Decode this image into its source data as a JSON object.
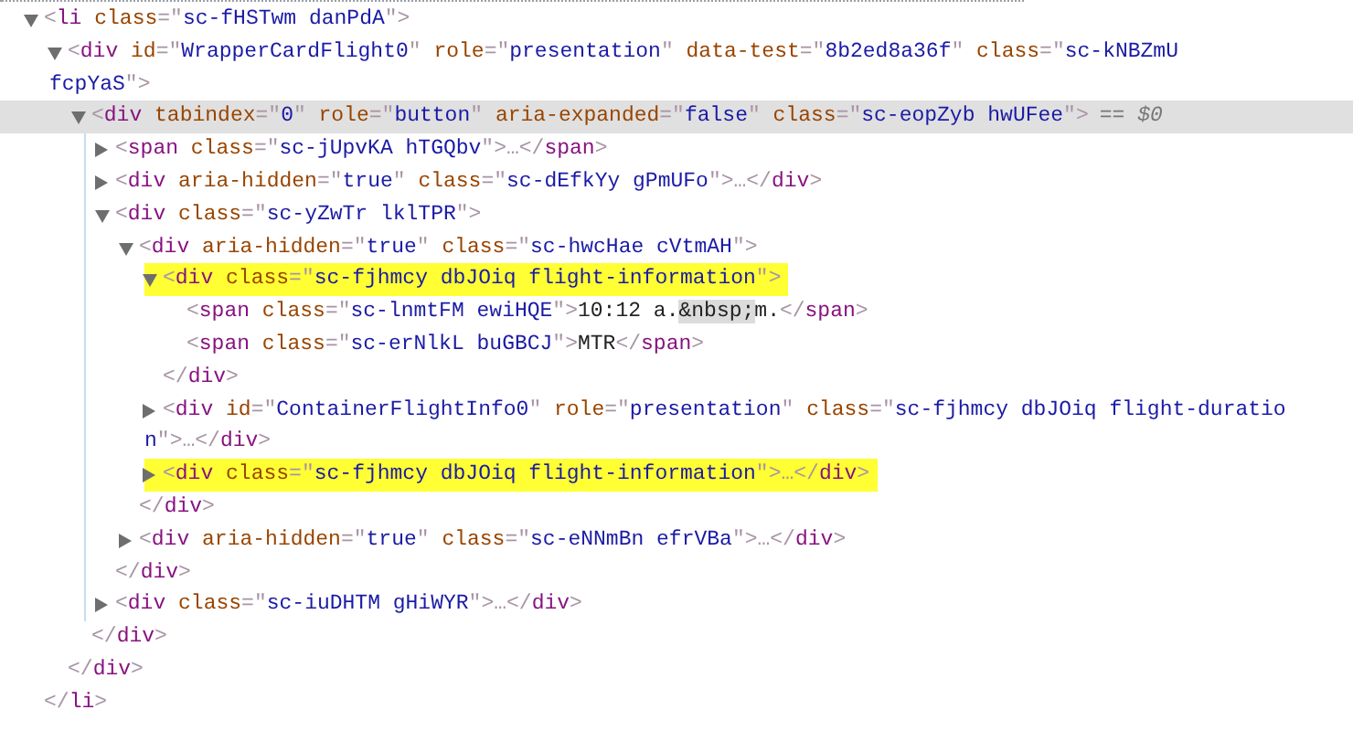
{
  "elements_tree": [
    {
      "kind": "toggle",
      "expanded": true,
      "selected": false,
      "highlighted": false,
      "lines": [
        "<li class=\"sc-fHSTwm danPdA\">"
      ],
      "close": "</li>",
      "children": [
        {
          "kind": "toggle",
          "expanded": true,
          "selected": false,
          "highlighted": false,
          "lines": [
            "<div id=\"WrapperCardFlight0\" role=\"presentation\" data-test=\"8b2ed8a36f\" class=\"sc-kNBZmU",
            "fcpYaS\">"
          ],
          "close": "</div>",
          "children": [
            {
              "kind": "toggle",
              "expanded": true,
              "selected": true,
              "highlighted": false,
              "lines": [
                "<div tabindex=\"0\" role=\"button\" aria-expanded=\"false\" class=\"sc-eopZyb hwUFee\">"
              ],
              "marker": "== $0",
              "close": "</div>",
              "children": [
                {
                  "kind": "toggle",
                  "expanded": false,
                  "selected": false,
                  "highlighted": false,
                  "lines": [
                    "<span class=\"sc-jUpvKA hTGQbv\">…</span>"
                  ]
                },
                {
                  "kind": "toggle",
                  "expanded": false,
                  "selected": false,
                  "highlighted": false,
                  "lines": [
                    "<div aria-hidden=\"true\" class=\"sc-dEfkYy gPmUFo\">…</div>"
                  ]
                },
                {
                  "kind": "toggle",
                  "expanded": true,
                  "selected": false,
                  "highlighted": false,
                  "lines": [
                    "<div class=\"sc-yZwTr lklTPR\">"
                  ],
                  "close": "</div>",
                  "children": [
                    {
                      "kind": "toggle",
                      "expanded": true,
                      "selected": false,
                      "highlighted": false,
                      "lines": [
                        "<div aria-hidden=\"true\" class=\"sc-hwcHae cVtmAH\">"
                      ],
                      "close": "</div>",
                      "children": [
                        {
                          "kind": "toggle",
                          "expanded": true,
                          "selected": false,
                          "highlighted": true,
                          "lines": [
                            "<div class=\"sc-fjhmcy dbJOiq flight-information\">"
                          ],
                          "close": "</div>",
                          "children": [
                            {
                              "kind": "leaf",
                              "selected": false,
                              "lines": [
                                "<span class=\"sc-lnmtFM ewiHQE\">10:12 a.&nbsp;m.</span>"
                              ]
                            },
                            {
                              "kind": "leaf",
                              "selected": false,
                              "lines": [
                                "<span class=\"sc-erNlkL buGBCJ\">MTR</span>"
                              ]
                            }
                          ]
                        },
                        {
                          "kind": "toggle",
                          "expanded": false,
                          "selected": false,
                          "highlighted": false,
                          "lines": [
                            "<div id=\"ContainerFlightInfo0\" role=\"presentation\" class=\"sc-fjhmcy dbJOiq flight-duratio",
                            "n\">…</div>"
                          ]
                        },
                        {
                          "kind": "toggle",
                          "expanded": false,
                          "selected": false,
                          "highlighted": true,
                          "lines": [
                            "<div class=\"sc-fjhmcy dbJOiq flight-information\">…</div>"
                          ]
                        }
                      ]
                    },
                    {
                      "kind": "toggle",
                      "expanded": false,
                      "selected": false,
                      "highlighted": false,
                      "lines": [
                        "<div aria-hidden=\"true\" class=\"sc-eNNmBn efrVBa\">…</div>"
                      ]
                    }
                  ]
                },
                {
                  "kind": "toggle",
                  "expanded": false,
                  "selected": false,
                  "highlighted": false,
                  "lines": [
                    "<div class=\"sc-iuDHTM gHiWYR\">…</div>"
                  ]
                }
              ]
            }
          ]
        }
      ]
    }
  ]
}
